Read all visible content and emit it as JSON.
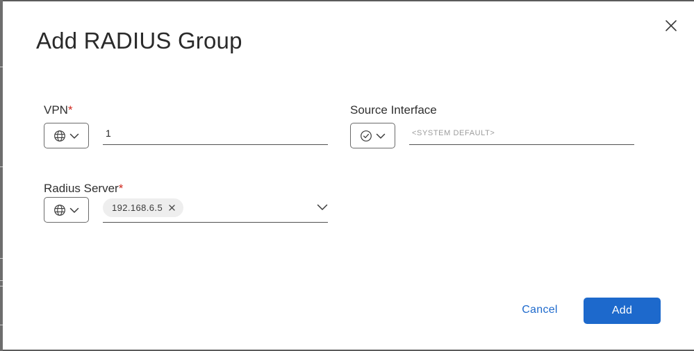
{
  "dialog": {
    "title": "Add RADIUS Group"
  },
  "vpn": {
    "label": "VPN",
    "required_mark": "*",
    "selector_icon": "globe-icon",
    "value": "1"
  },
  "source_interface": {
    "label": "Source Interface",
    "selector_icon": "check-circle-icon",
    "value": "",
    "placeholder": "<SYSTEM DEFAULT>"
  },
  "radius_server": {
    "label": "Radius Server",
    "required_mark": "*",
    "selector_icon": "globe-icon",
    "selected": [
      "192.168.6.5"
    ]
  },
  "actions": {
    "cancel_label": "Cancel",
    "add_label": "Add"
  },
  "colors": {
    "primary": "#1d69cc",
    "required": "#d0271d"
  }
}
